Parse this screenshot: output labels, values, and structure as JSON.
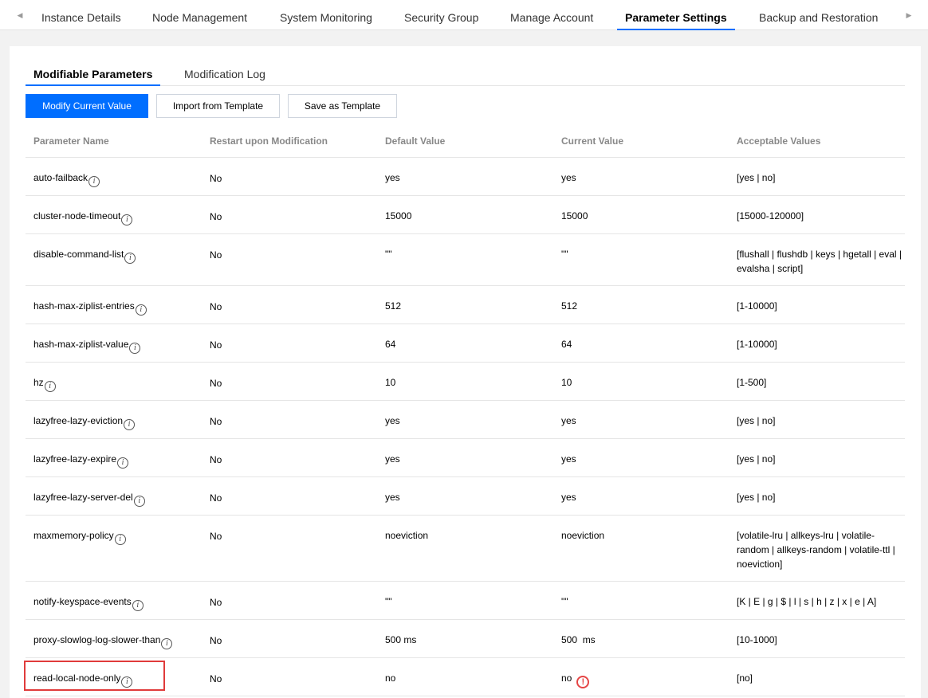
{
  "top_tabs": [
    {
      "label": "Instance Details"
    },
    {
      "label": "Node Management"
    },
    {
      "label": "System Monitoring"
    },
    {
      "label": "Security Group"
    },
    {
      "label": "Manage Account"
    },
    {
      "label": "Parameter Settings",
      "active": true
    },
    {
      "label": "Backup and Restoration"
    }
  ],
  "sub_tabs": [
    {
      "label": "Modifiable Parameters",
      "active": true
    },
    {
      "label": "Modification Log"
    }
  ],
  "toolbar": {
    "modify_label": "Modify Current Value",
    "import_label": "Import from Template",
    "save_label": "Save as Template"
  },
  "table": {
    "headers": [
      "Parameter Name",
      "Restart upon Modification",
      "Default Value",
      "Current Value",
      "Acceptable Values"
    ],
    "rows": [
      {
        "name": "auto-failback",
        "restart": "No",
        "default": "yes",
        "current": "yes",
        "acceptable": "[yes | no]"
      },
      {
        "name": "cluster-node-timeout",
        "restart": "No",
        "default": "15000",
        "current": "15000",
        "acceptable": "[15000-120000]"
      },
      {
        "name": "disable-command-list",
        "restart": "No",
        "default": "\"\"",
        "current": "\"\"",
        "acceptable": "[flushall | flushdb | keys | hgetall | eval | evalsha | script]"
      },
      {
        "name": "hash-max-ziplist-entries",
        "restart": "No",
        "default": "512",
        "current": "512",
        "acceptable": "[1-10000]"
      },
      {
        "name": "hash-max-ziplist-value",
        "restart": "No",
        "default": "64",
        "current": "64",
        "acceptable": "[1-10000]"
      },
      {
        "name": "hz",
        "restart": "No",
        "default": "10",
        "current": "10",
        "acceptable": "[1-500]"
      },
      {
        "name": "lazyfree-lazy-eviction",
        "restart": "No",
        "default": "yes",
        "current": "yes",
        "acceptable": "[yes | no]"
      },
      {
        "name": "lazyfree-lazy-expire",
        "restart": "No",
        "default": "yes",
        "current": "yes",
        "acceptable": "[yes | no]"
      },
      {
        "name": "lazyfree-lazy-server-del",
        "restart": "No",
        "default": "yes",
        "current": "yes",
        "acceptable": "[yes | no]"
      },
      {
        "name": "maxmemory-policy",
        "restart": "No",
        "default": "noeviction",
        "current": "noeviction",
        "acceptable": "[volatile-lru | allkeys-lru | volatile-random | allkeys-random | volatile-ttl | noeviction]"
      },
      {
        "name": "notify-keyspace-events",
        "restart": "No",
        "default": "\"\"",
        "current": "\"\"",
        "acceptable": "[K | E | g | $ | l | s | h | z | x | e | A]"
      },
      {
        "name": "proxy-slowlog-log-slower-than",
        "restart": "No",
        "default": "500 ms",
        "current": "500  ms",
        "acceptable": "[10-1000]"
      },
      {
        "name": "read-local-node-only",
        "restart": "No",
        "default": "no",
        "current": "no",
        "acceptable": "[no]",
        "warning": true,
        "highlighted": true
      }
    ]
  },
  "icons": {
    "info": "info-icon",
    "warning": "warning-icon",
    "warning_color": "#e54545"
  },
  "colors": {
    "accent": "#006eff",
    "highlight_border": "#e03b3b"
  }
}
